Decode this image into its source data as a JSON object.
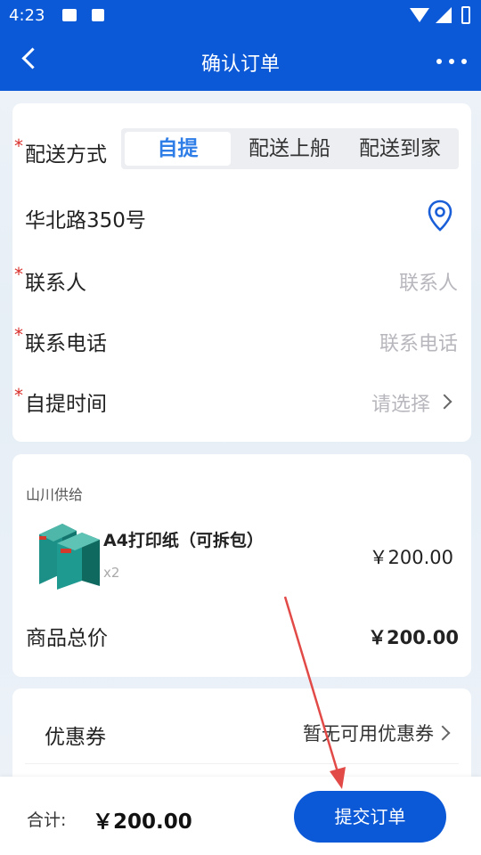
{
  "status_bar": {
    "time": "4:23"
  },
  "header": {
    "title": "确认订单"
  },
  "delivery": {
    "required_mark": "*",
    "label": "配送方式",
    "options": [
      "自提",
      "配送上船",
      "配送到家"
    ],
    "selected": "自提"
  },
  "address": {
    "text": "华北路350号"
  },
  "contact": {
    "required_mark": "*",
    "label": "联系人",
    "placeholder": "联系人"
  },
  "phone": {
    "required_mark": "*",
    "label": "联系电话",
    "placeholder": "联系电话"
  },
  "pickup_time": {
    "required_mark": "*",
    "label": "自提时间",
    "placeholder": "请选择"
  },
  "order": {
    "supplier": "山川供给",
    "product": {
      "name": "A4打印纸（可拆包）",
      "qty": "x2",
      "price": "￥200.00"
    },
    "total_label": "商品总价",
    "total_value": "￥200.00"
  },
  "coupon": {
    "label": "优惠券",
    "value": "暂无可用优惠券"
  },
  "footer": {
    "sum_label": "合计:",
    "sum_value": "￥200.00",
    "submit_label": "提交订单"
  },
  "colors": {
    "primary": "#0c59d8",
    "active_tab": "#2f7ee8",
    "required": "#d9302c",
    "annotation_arrow": "#e24a47"
  }
}
